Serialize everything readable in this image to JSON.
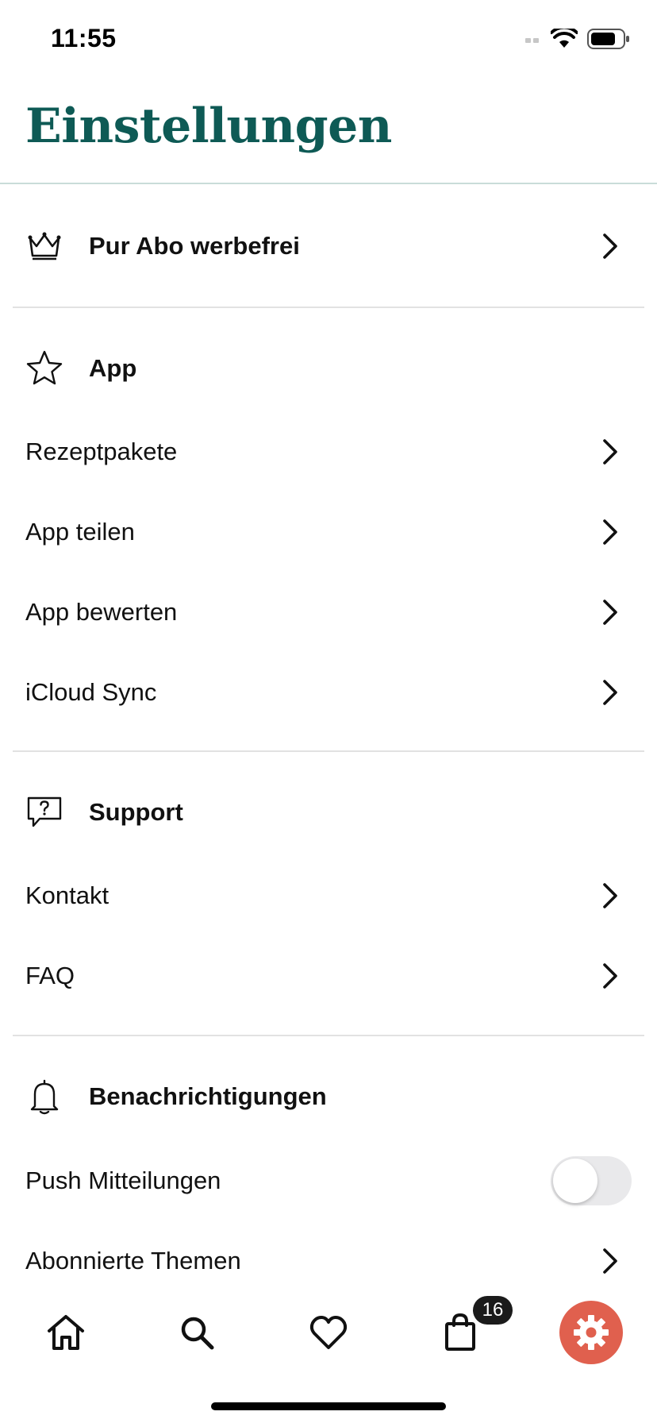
{
  "status_bar": {
    "time": "11:55"
  },
  "title": "Einstellungen",
  "premium": {
    "label": "Pur Abo werbefrei",
    "icon": "crown-icon"
  },
  "sections": {
    "app": {
      "title": "App",
      "icon": "star-icon",
      "items": [
        "Rezeptpakete",
        "App teilen",
        "App bewerten",
        "iCloud Sync"
      ]
    },
    "support": {
      "title": "Support",
      "icon": "help-bubble-icon",
      "items": [
        "Kontakt",
        "FAQ"
      ]
    },
    "notifications": {
      "title": "Benachrichtigungen",
      "icon": "bell-icon",
      "push_label": "Push Mitteilungen",
      "push_enabled": false,
      "topics_label": "Abonnierte Themen"
    }
  },
  "tab_bar": {
    "tabs": [
      "home-icon",
      "search-icon",
      "heart-icon",
      "shopping-bag-icon",
      "gear-icon"
    ],
    "cart_badge": "16",
    "active_tab": "settings",
    "accent_color": "#e0604e"
  },
  "colors": {
    "title": "#0e5a55",
    "divider": "#e2e2e2"
  }
}
